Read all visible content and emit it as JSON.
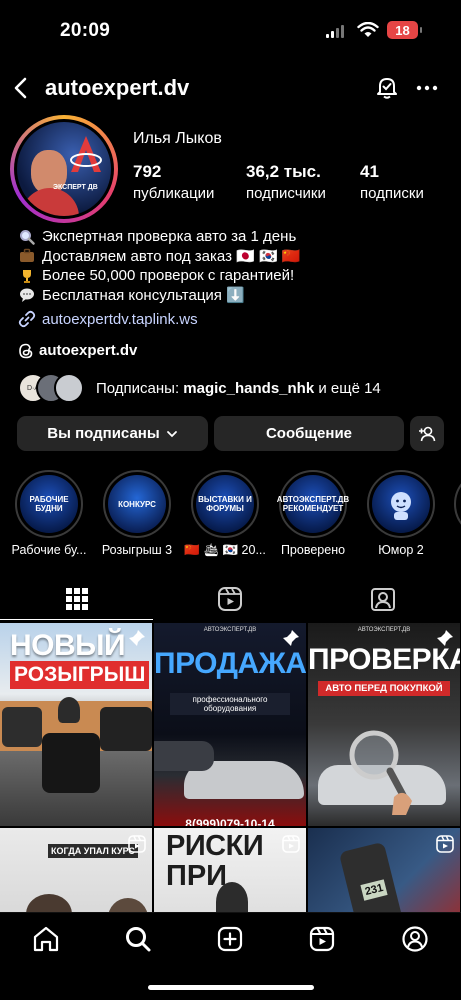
{
  "status_bar": {
    "time": "20:09",
    "battery": "18"
  },
  "header": {
    "username": "autoexpert.dv"
  },
  "profile": {
    "full_name": "Илья Лыков",
    "avatar_text": "ЭКСПЕРТ ДВ",
    "stats": [
      {
        "value": "792",
        "label": "публикации"
      },
      {
        "value": "36,2 тыс.",
        "label": "подписчики"
      },
      {
        "value": "41",
        "label": "подписки"
      }
    ],
    "bio": [
      {
        "icon": "magnifier-icon",
        "text": "Экспертная проверка авто за 1 день"
      },
      {
        "icon": "briefcase-icon",
        "text": "Доставляем авто под заказ 🇯🇵 🇰🇷 🇨🇳"
      },
      {
        "icon": "trophy-icon",
        "text": "Более 50,000 проверок с гарантией!"
      },
      {
        "icon": "speech-bubble-icon",
        "text": "Бесплатная консультация ⬇️"
      }
    ],
    "link": "autoexpertdv.taplink.ws",
    "threads": "autoexpert.dv",
    "followed_by": {
      "prefix": "Подписаны: ",
      "name": "magic_hands_nhk",
      "suffix": " и ещё 14"
    }
  },
  "buttons": {
    "following": "Вы подписаны",
    "message": "Сообщение"
  },
  "highlights": [
    {
      "label": "Рабочие бу...",
      "cover": "РАБОЧИЕ БУДНИ"
    },
    {
      "label": "Розыгрыш 3",
      "cover": "КОНКУРС"
    },
    {
      "label": "🇨🇳 🛳 🇰🇷 20...",
      "cover": "ВЫСТАВКИ И ФОРУМЫ"
    },
    {
      "label": "Проверено",
      "cover": "АВТОЭКСПЕРТ.ДВ РЕКОМЕНДУЕТ"
    },
    {
      "label": "Юмор 2",
      "cover": ""
    }
  ],
  "posts": [
    {
      "title1": "НОВЫЙ",
      "title2": "РОЗЫГРЫШ",
      "pinned": true
    },
    {
      "brand": "АВТОЭКСПЕРТ.ДВ",
      "title1": "ПРОДАЖА",
      "title2": "профессионального оборудования",
      "phone": "8(999)079-10-14",
      "pinned": true
    },
    {
      "brand": "АВТОЭКСПЕРТ.ДВ",
      "title1": "ПРОВЕРКА",
      "title2": "АВТО ПЕРЕД ПОКУПКОЙ",
      "pinned": true
    },
    {
      "title1": "КОГДА УПАЛ КУРС",
      "reel": true
    },
    {
      "title1": "РИСКИ",
      "title2": "ПРИ",
      "reel": true
    },
    {
      "title1": "231",
      "reel": true
    }
  ],
  "colors": {
    "background": "#000000",
    "button": "#262626",
    "link": "#c8d4ff",
    "battery": "#e64545"
  }
}
